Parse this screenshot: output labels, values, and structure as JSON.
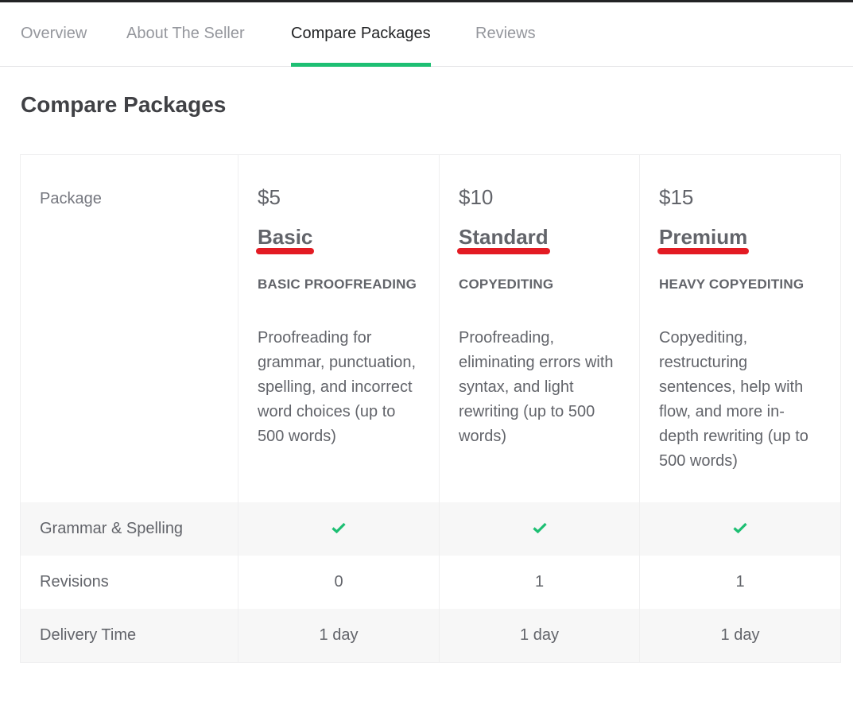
{
  "tabs": [
    {
      "label": "Overview",
      "active": false
    },
    {
      "label": "About The Seller",
      "active": false
    },
    {
      "label": "Compare Packages",
      "active": true
    },
    {
      "label": "Reviews",
      "active": false
    }
  ],
  "page_title": "Compare Packages",
  "colors": {
    "accent": "#1dbf73",
    "underline_annotation": "#e31b23",
    "check": "#1dbf73"
  },
  "table": {
    "package_label": "Package",
    "packages": [
      {
        "price": "$5",
        "name": "Basic",
        "title": "BASIC PROOFREADING",
        "description": "Proofreading for grammar, punctuation, spelling, and incorrect word choices (up to 500 words)"
      },
      {
        "price": "$10",
        "name": "Standard",
        "title": "COPYEDITING",
        "description": "Proofreading, eliminating errors with syntax, and light rewriting (up to 500 words)"
      },
      {
        "price": "$15",
        "name": "Premium",
        "title": "HEAVY COPYEDITING",
        "description": "Copyediting, restructuring sentences, help with flow, and more in-depth rewriting (up to 500 words)"
      }
    ],
    "features": [
      {
        "label": "Grammar & Spelling",
        "values": [
          "check-icon",
          "check-icon",
          "check-icon"
        ]
      },
      {
        "label": "Revisions",
        "values": [
          "0",
          "1",
          "1"
        ]
      },
      {
        "label": "Delivery Time",
        "values": [
          "1 day",
          "1 day",
          "1 day"
        ]
      }
    ]
  }
}
